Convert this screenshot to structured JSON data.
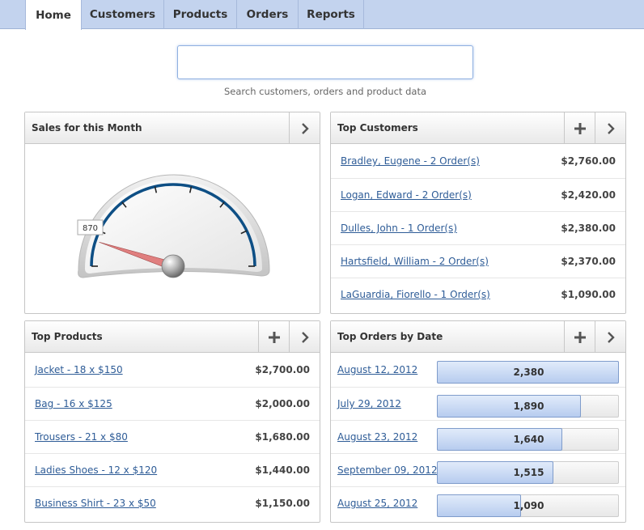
{
  "nav": {
    "tabs": [
      {
        "label": "Home",
        "active": true
      },
      {
        "label": "Customers",
        "active": false
      },
      {
        "label": "Products",
        "active": false
      },
      {
        "label": "Orders",
        "active": false
      },
      {
        "label": "Reports",
        "active": false
      }
    ]
  },
  "search": {
    "value": "",
    "hint": "Search customers, orders and product data"
  },
  "sales": {
    "title": "Sales for this Month",
    "gauge_value": "870",
    "gauge_level": 0.1
  },
  "top_customers": {
    "title": "Top Customers",
    "rows": [
      {
        "label": "Bradley, Eugene - 2 Order(s)",
        "amount": "$2,760.00"
      },
      {
        "label": "Logan, Edward - 2 Order(s)",
        "amount": "$2,420.00"
      },
      {
        "label": "Dulles, John - 1 Order(s)",
        "amount": "$2,380.00"
      },
      {
        "label": "Hartsfield, William - 2 Order(s)",
        "amount": "$2,370.00"
      },
      {
        "label": "LaGuardia, Fiorello - 1 Order(s)",
        "amount": "$1,090.00"
      }
    ]
  },
  "top_products": {
    "title": "Top Products",
    "rows": [
      {
        "label": "Jacket - 18 x $150",
        "amount": "$2,700.00"
      },
      {
        "label": "Bag - 16 x $125",
        "amount": "$2,000.00"
      },
      {
        "label": "Trousers - 21 x $80",
        "amount": "$1,680.00"
      },
      {
        "label": "Ladies Shoes - 12 x $120",
        "amount": "$1,440.00"
      },
      {
        "label": "Business Shirt - 23 x $50",
        "amount": "$1,150.00"
      }
    ]
  },
  "top_orders": {
    "title": "Top Orders by Date",
    "rows": [
      {
        "date": "August 12, 2012",
        "value": "2,380",
        "fraction": 1.0
      },
      {
        "date": "July 29, 2012",
        "value": "1,890",
        "fraction": 0.79
      },
      {
        "date": "August 23, 2012",
        "value": "1,640",
        "fraction": 0.69
      },
      {
        "date": "September 09, 2012",
        "value": "1,515",
        "fraction": 0.64
      },
      {
        "date": "August 25, 2012",
        "value": "1,090",
        "fraction": 0.46
      }
    ]
  },
  "icons": {
    "plus": "plus-icon",
    "chevron": "chevron-right-icon"
  },
  "colors": {
    "nav_bg": "#c3d3ee",
    "link": "#2e5c97",
    "bar_fill": "#b7ccef",
    "gauge_ring": "#0e4f85",
    "needle": "#e07f7f"
  }
}
